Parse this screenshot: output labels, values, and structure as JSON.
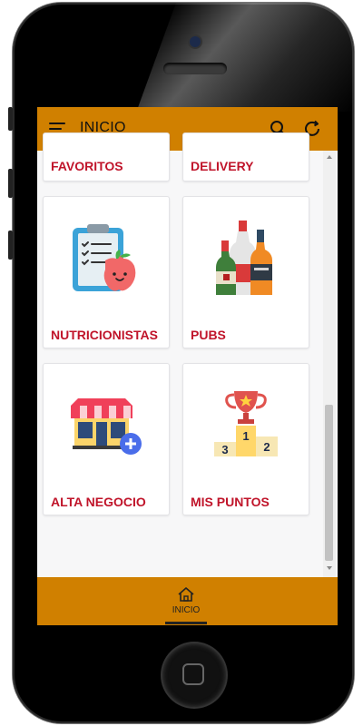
{
  "topbar": {
    "title": "INICIO",
    "menu_icon": "hamburger-menu-icon",
    "search_icon": "search-icon",
    "refresh_icon": "refresh-icon"
  },
  "categories": [
    {
      "label": "FAVORITOS",
      "icon": "favorites-icon"
    },
    {
      "label": "DELIVERY",
      "icon": "delivery-icon"
    },
    {
      "label": "NUTRICIONISTAS",
      "icon": "clipboard-apple-icon"
    },
    {
      "label": "PUBS",
      "icon": "bottles-icon"
    },
    {
      "label": "ALTA NEGOCIO",
      "icon": "store-add-icon"
    },
    {
      "label": "MIS PUNTOS",
      "icon": "trophy-podium-icon"
    }
  ],
  "bottom_nav": {
    "home_label": "INICIO",
    "home_icon": "home-icon"
  },
  "colors": {
    "bar": "#d08000",
    "label": "#c0142a"
  }
}
